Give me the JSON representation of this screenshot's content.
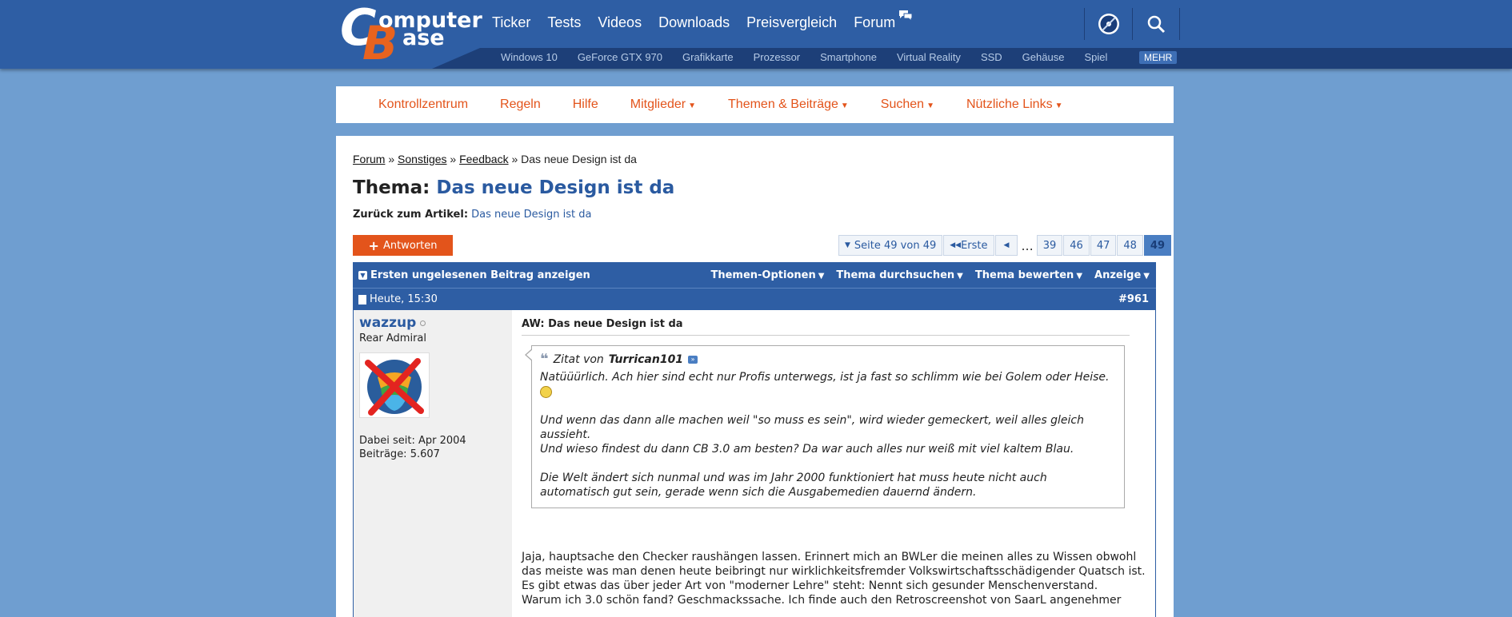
{
  "site": {
    "logo_text": "Computer Base",
    "main_nav": [
      "Ticker",
      "Tests",
      "Videos",
      "Downloads",
      "Preisvergleich",
      "Forum"
    ],
    "sub_nav": [
      "Windows 10",
      "GeForce GTX 970",
      "Grafikkarte",
      "Prozessor",
      "Smartphone",
      "Virtual Reality",
      "SSD",
      "Gehäuse",
      "Spiel"
    ],
    "more_label": "MEHR",
    "icons": [
      "cd-icon",
      "search-icon",
      "chat-bubble-icon"
    ],
    "colors": {
      "header": "#2e5ea4",
      "subheader": "#1d3f78",
      "background": "#6f9ed0",
      "accent": "#e3541b"
    }
  },
  "forum_nav": [
    {
      "label": "Kontrollzentrum",
      "dropdown": false
    },
    {
      "label": "Regeln",
      "dropdown": false
    },
    {
      "label": "Hilfe",
      "dropdown": false
    },
    {
      "label": "Mitglieder",
      "dropdown": true
    },
    {
      "label": "Themen & Beiträge",
      "dropdown": true
    },
    {
      "label": "Suchen",
      "dropdown": true
    },
    {
      "label": "Nützliche Links",
      "dropdown": true
    }
  ],
  "breadcrumb": {
    "items": [
      "Forum",
      "Sonstiges",
      "Feedback"
    ],
    "separator": "»",
    "current": "Das neue Design ist da"
  },
  "thread": {
    "title_label": "Thema:",
    "title": "Das neue Design ist da",
    "back_label": "Zurück zum Artikel:",
    "back_link": "Das neue Design ist da",
    "reply_label": "Antworten"
  },
  "pagination": {
    "page_info": "Seite 49 von 49",
    "first_label": "Erste",
    "prev_icon": "caret-left-icon",
    "ellipsis": "...",
    "pages": [
      "39",
      "46",
      "47",
      "48",
      "49"
    ],
    "current": "49"
  },
  "thread_bar": {
    "first_unread": "Ersten ungelesenen Beitrag anzeigen",
    "tools": [
      "Themen-Optionen",
      "Thema durchsuchen",
      "Thema bewerten",
      "Anzeige"
    ]
  },
  "post": {
    "date": "Heute, 15:30",
    "number": "#961",
    "user": {
      "name": "wazzup",
      "rank": "Rear Admiral",
      "joined": "Dabei seit: Apr 2004",
      "posts": "Beiträge: 5.607"
    },
    "title": "AW: Das neue Design ist da",
    "quote": {
      "prefix": "Zitat von",
      "author": "Turrican101",
      "paragraphs": [
        "Natüüürlich. Ach hier sind echt nur Profis unterwegs, ist ja fast so schlimm wie bei Golem oder Heise.",
        "Und wenn das dann alle machen weil \"so muss es sein\", wird wieder gemeckert, weil alles gleich aussieht.",
        "Und wieso findest du dann CB 3.0 am besten? Da war auch alles nur weiß mit viel kaltem Blau.",
        "Die Welt ändert sich nunmal und was im Jahr 2000 funktioniert hat muss heute nicht auch automatisch gut sein, gerade wenn sich die Ausgabemedien dauernd ändern."
      ]
    },
    "body": [
      "Jaja, hauptsache den Checker raushängen lassen. Erinnert mich an BWLer die meinen alles zu Wissen obwohl das meiste was man denen heute beibringt nur wirklichkeitsfremder Volkswirtschaftsschädigender Quatsch ist. Es gibt etwas das über jeder Art von \"moderner Lehre\" steht: Nennt sich gesunder Menschenverstand.",
      "Warum ich 3.0 schön fand? Geschmackssache. Ich finde auch den Retroscreenshot von SaarL angenehmer"
    ]
  }
}
